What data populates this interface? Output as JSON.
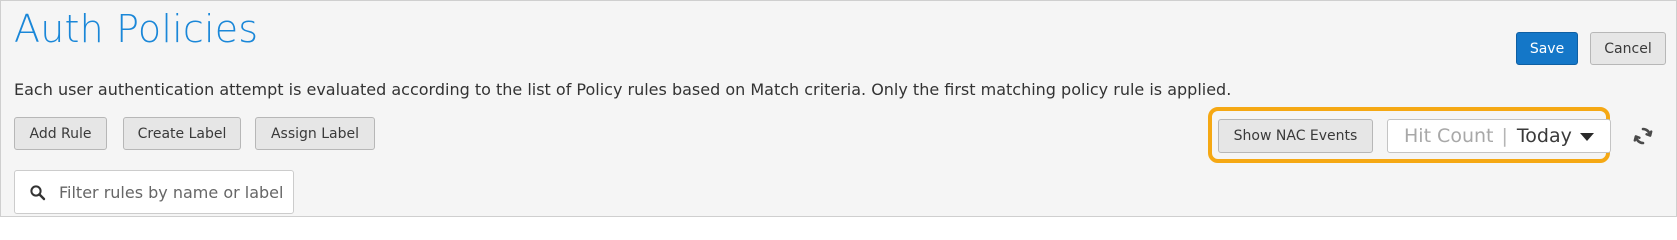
{
  "page": {
    "title": "Auth Policies",
    "description": "Each user authentication attempt is evaluated according to the list of Policy rules based on Match criteria. Only the first matching policy rule is applied."
  },
  "header_actions": {
    "save_label": "Save",
    "cancel_label": "Cancel"
  },
  "toolbar": {
    "add_rule_label": "Add Rule",
    "create_label_label": "Create Label",
    "assign_label_label": "Assign Label",
    "show_nac_events_label": "Show NAC Events",
    "hit_count": {
      "label": "Hit Count",
      "separator": "|",
      "selected": "Today",
      "icon": "caret-down-icon"
    },
    "refresh_icon": "refresh-icon"
  },
  "filter": {
    "placeholder": "Filter rules by name or label",
    "value": "",
    "icon": "search-icon"
  },
  "colors": {
    "title": "#1a87d8",
    "primary_button": "#1477c8",
    "highlight": "#f5a814"
  }
}
